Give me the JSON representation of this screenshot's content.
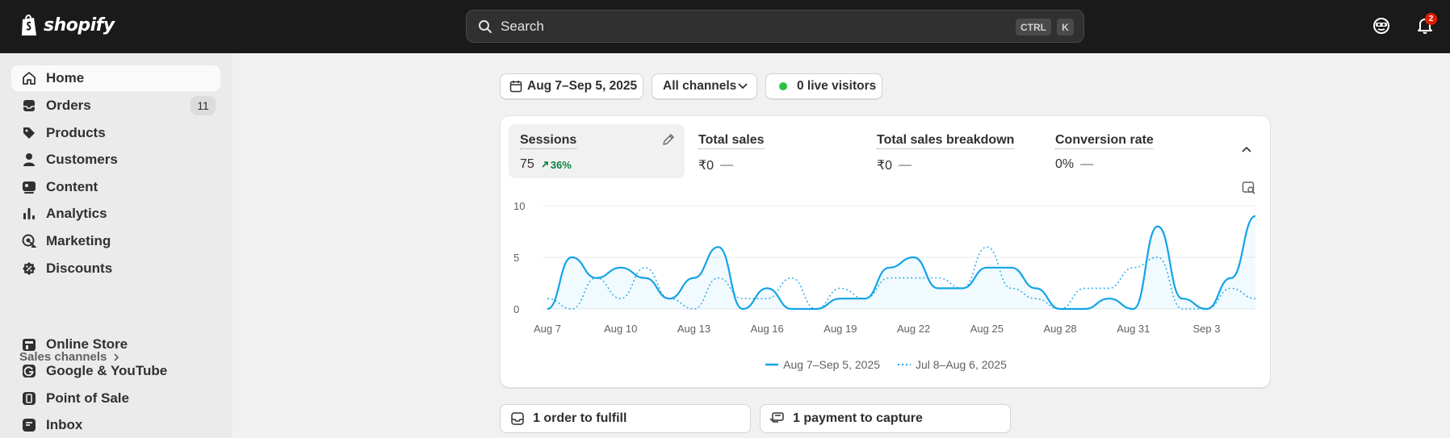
{
  "topbar": {
    "logo_text": "shopify",
    "search_placeholder": "Search",
    "shortcut_ctrl": "CTRL",
    "shortcut_k": "K",
    "notification_count": "2"
  },
  "sidebar": {
    "items": [
      {
        "label": "Home",
        "icon": "home-icon"
      },
      {
        "label": "Orders",
        "icon": "orders-icon",
        "count": "11"
      },
      {
        "label": "Products",
        "icon": "tag-icon"
      },
      {
        "label": "Customers",
        "icon": "person-icon"
      },
      {
        "label": "Content",
        "icon": "content-icon"
      },
      {
        "label": "Analytics",
        "icon": "bar-chart-icon"
      },
      {
        "label": "Marketing",
        "icon": "target-icon"
      },
      {
        "label": "Discounts",
        "icon": "discount-icon"
      }
    ],
    "sales_channels_label": "Sales channels",
    "channels": [
      {
        "label": "Online Store",
        "icon": "store-icon"
      },
      {
        "label": "Google & YouTube",
        "icon": "google-icon"
      },
      {
        "label": "Point of Sale",
        "icon": "pos-icon"
      },
      {
        "label": "Inbox",
        "icon": "inbox-icon"
      }
    ]
  },
  "filters": {
    "date_range": "Aug 7–Sep 5, 2025",
    "channel": "All channels",
    "live_visitors": "0 live visitors"
  },
  "metrics": [
    {
      "label": "Sessions",
      "value": "75",
      "change": "36%"
    },
    {
      "label": "Total sales",
      "value": "₹0",
      "dash": "—"
    },
    {
      "label": "Total sales breakdown",
      "value": "₹0",
      "dash": "—"
    },
    {
      "label": "Conversion rate",
      "value": "0%",
      "dash": "—"
    }
  ],
  "colors": {
    "accent": "#13a3e6",
    "positive": "#0c8040",
    "live_dot": "#29c241"
  },
  "chart_data": {
    "type": "line",
    "x": [
      "Aug 7",
      "Aug 8",
      "Aug 9",
      "Aug 10",
      "Aug 11",
      "Aug 12",
      "Aug 13",
      "Aug 14",
      "Aug 15",
      "Aug 16",
      "Aug 17",
      "Aug 18",
      "Aug 19",
      "Aug 20",
      "Aug 21",
      "Aug 22",
      "Aug 23",
      "Aug 24",
      "Aug 25",
      "Aug 26",
      "Aug 27",
      "Aug 28",
      "Aug 29",
      "Aug 30",
      "Aug 31",
      "Sep 1",
      "Sep 2",
      "Sep 3",
      "Sep 4",
      "Sep 5"
    ],
    "x_tick_labels": [
      "Aug 7",
      "Aug 10",
      "Aug 13",
      "Aug 16",
      "Aug 19",
      "Aug 22",
      "Aug 25",
      "Aug 28",
      "Aug 31",
      "Sep 3"
    ],
    "y_ticks": [
      "0",
      "5",
      "10"
    ],
    "ylim": [
      0,
      10
    ],
    "series": [
      {
        "name": "Aug 7–Sep 5, 2025",
        "style": "solid",
        "values": [
          0,
          5,
          3,
          4,
          3,
          1,
          3,
          6,
          0,
          2,
          0,
          0,
          1,
          1,
          4,
          5,
          2,
          2,
          4,
          4,
          2,
          0,
          0,
          1,
          0,
          8,
          1,
          0,
          3,
          9
        ]
      },
      {
        "name": "Jul 8–Aug 6, 2025",
        "style": "dotted",
        "values": [
          1,
          0,
          3,
          1,
          4,
          1,
          0,
          3,
          1,
          1,
          3,
          0,
          2,
          1,
          3,
          3,
          3,
          2,
          6,
          2,
          1,
          0,
          2,
          2,
          4,
          5,
          0,
          0,
          2,
          1
        ]
      }
    ],
    "grid": true,
    "legend_position": "bottom"
  },
  "tasks": [
    {
      "label": "1 order to fulfill",
      "icon": "inbox-icon"
    },
    {
      "label": "1 payment to capture",
      "icon": "payment-icon"
    }
  ]
}
